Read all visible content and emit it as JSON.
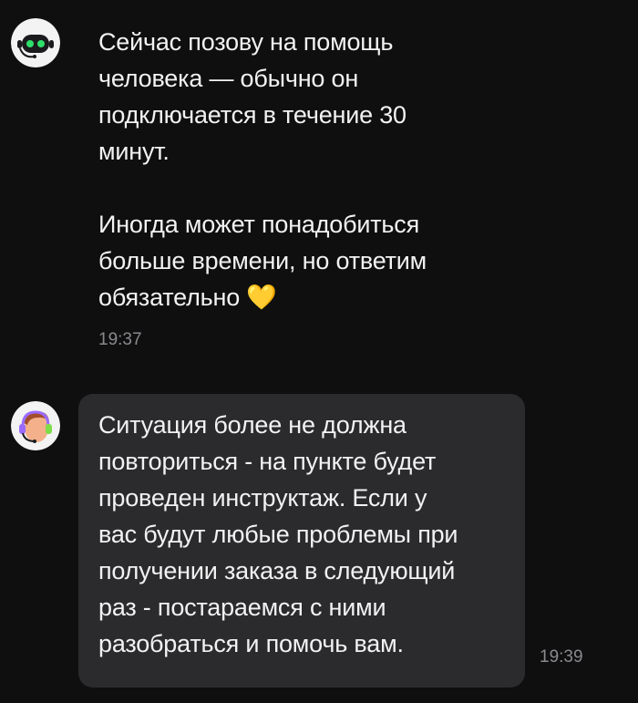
{
  "messages": [
    {
      "sender": "bot",
      "avatar_icon": "robot-support-icon",
      "text": "Сейчас позову на помощь\nчеловека — обычно он\nподключается в течение 30\nминут.\n\nИногда может понадобиться\nбольше времени, но ответим\nобязательно 💛",
      "time": "19:37"
    },
    {
      "sender": "operator",
      "avatar_icon": "support-operator-headset-icon",
      "text": "Ситуация более не должна\nповториться - на пункте будет\nпроведен инструктаж. Если у\nвас будут любые проблемы при\nполучении заказа в следующий\nраз - постараемся с ними\nразобраться и помочь вам.",
      "time": "19:39"
    }
  ],
  "colors": {
    "background": "#0f0f10",
    "bubble": "#2b2b2e",
    "text": "#f2f2f2",
    "timestamp": "#8a8a8e",
    "bot_eye": "#2ee06a",
    "operator_headset": "#9b6bff"
  }
}
